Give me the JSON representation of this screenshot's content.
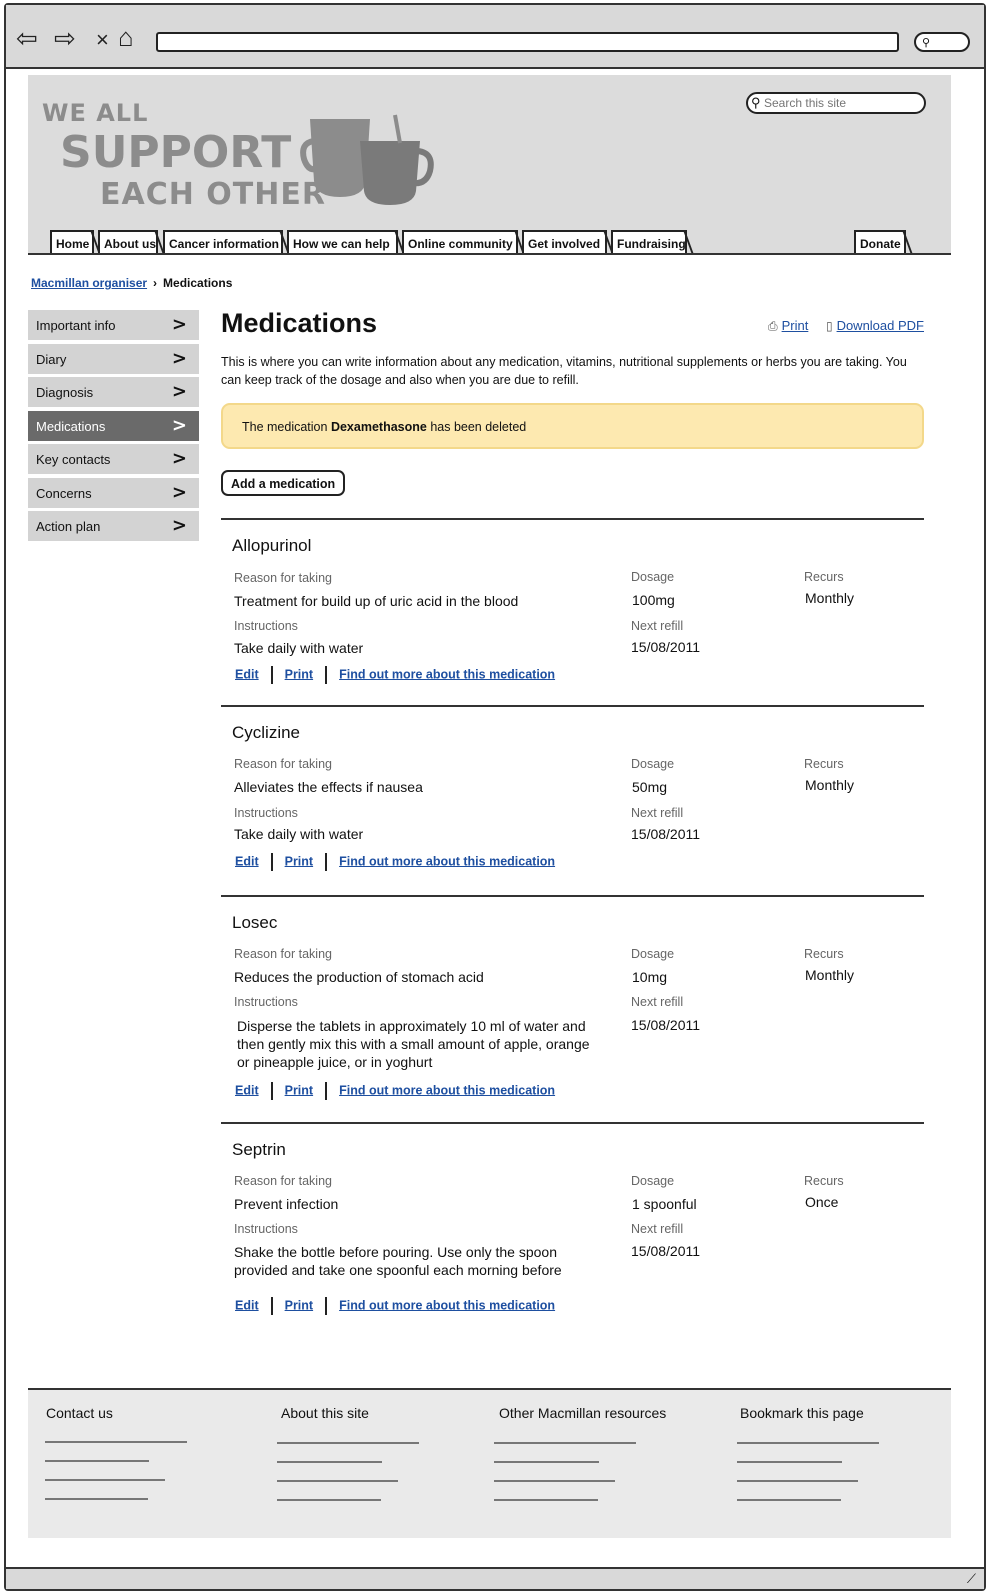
{
  "browser": {
    "back_icon": "back-arrow-icon",
    "forward_icon": "forward-arrow-icon",
    "close_glyph": "×",
    "home_icon": "home-icon",
    "search_icon": "magnifier-icon"
  },
  "header": {
    "logo": [
      "WE ALL",
      "SUPPORT",
      "EACH OTHER"
    ],
    "search_placeholder": "Search this site",
    "nav_tabs": [
      "Home",
      "About us",
      "Cancer information",
      "How we can help",
      "Online community",
      "Get involved",
      "Fundraising"
    ],
    "donate": "Donate"
  },
  "breadcrumb": {
    "parent": "Macmillan organiser",
    "current": "Medications"
  },
  "sidebar": {
    "items": [
      {
        "label": "Important info"
      },
      {
        "label": "Diary"
      },
      {
        "label": "Diagnosis"
      },
      {
        "label": "Medications",
        "active": true
      },
      {
        "label": "Key contacts"
      },
      {
        "label": "Concerns"
      },
      {
        "label": "Action plan"
      }
    ]
  },
  "main": {
    "title": "Medications",
    "print_label": "Print",
    "download_label": "Download PDF",
    "intro": "This is where you can write information about any medication, vitamins, nutritional supplements or herbs you are taking. You can keep track of the dosage and also when you are due to refill.",
    "notice": {
      "prefix": "The medication",
      "name": "Dexamethasone",
      "suffix": "has been deleted"
    },
    "add_button": "Add a medication",
    "labels": {
      "reason": "Reason for taking",
      "instructions": "Instructions",
      "dosage": "Dosage",
      "next_refill": "Next refill",
      "recurs": "Recurs"
    },
    "links": {
      "edit": "Edit",
      "print": "Print",
      "more": "Find out more about this medication"
    },
    "medications": [
      {
        "name": "Allopurinol",
        "reason": "Treatment for build up of uric acid in the blood",
        "instructions": "Take daily with water",
        "dosage": "100mg",
        "next_refill": "15/08/2011",
        "recurs": "Monthly"
      },
      {
        "name": "Cyclizine",
        "reason": "Alleviates the effects if nausea",
        "instructions": "Take daily with water",
        "dosage": "50mg",
        "next_refill": "15/08/2011",
        "recurs": "Monthly"
      },
      {
        "name": "Losec",
        "reason": "Reduces the production of stomach acid",
        "instructions": "Disperse the tablets in approximately 10 ml of water and then gently mix this with a small amount of apple, orange or pineapple juice, or in yoghurt",
        "dosage": "10mg",
        "next_refill": "15/08/2011",
        "recurs": "Monthly"
      },
      {
        "name": "Septrin",
        "reason": "Prevent infection",
        "instructions": "Shake the bottle before pouring. Use only the spoon provided and take one spoonful each morning before",
        "dosage": "1 spoonful",
        "next_refill": "15/08/2011",
        "recurs": "Once"
      }
    ]
  },
  "footer": {
    "columns": [
      "Contact us",
      "About this site",
      "Other Macmillan resources",
      "Bookmark this page"
    ]
  }
}
